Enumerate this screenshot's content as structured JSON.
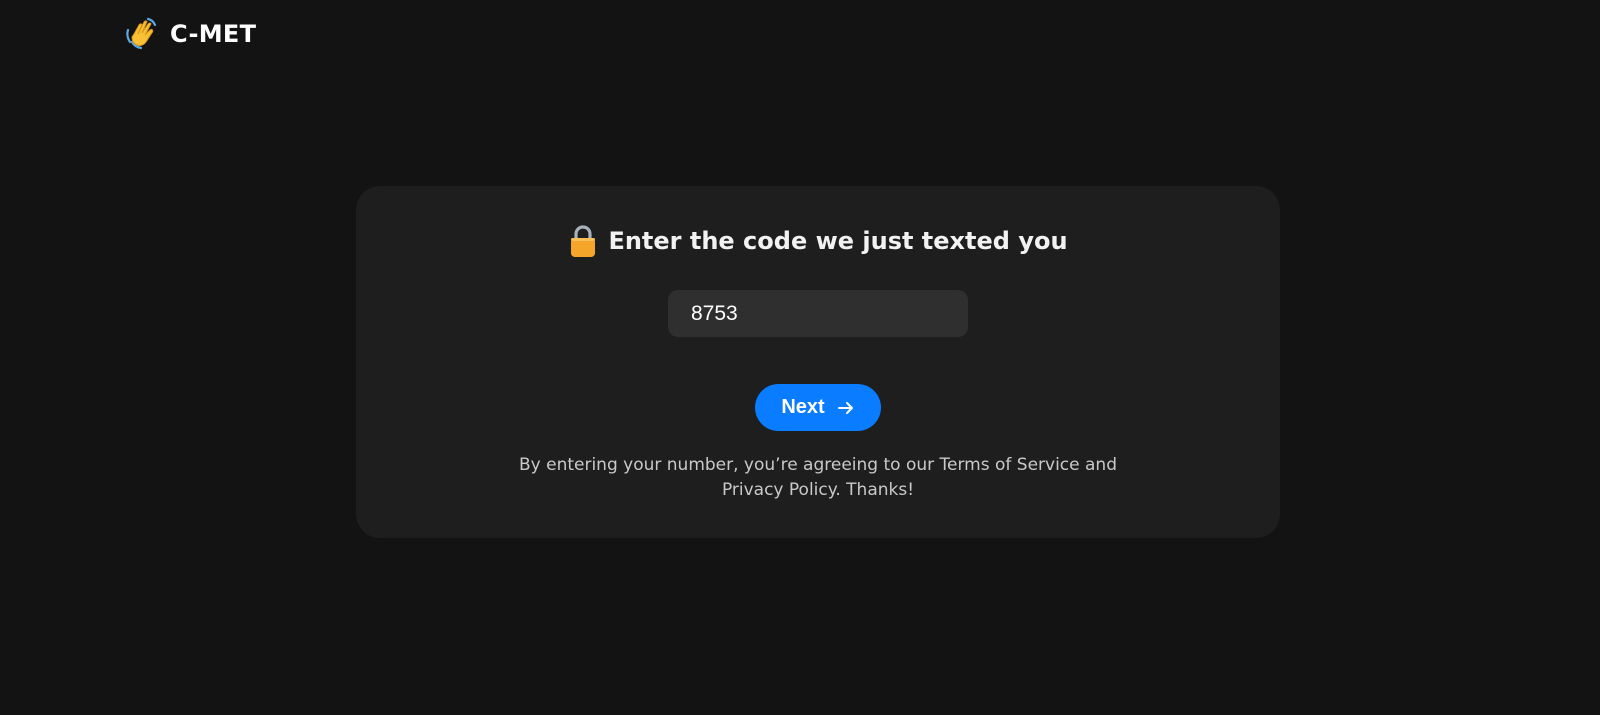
{
  "brand": {
    "name": "C-MET",
    "icon": "waving-hand-icon"
  },
  "verification": {
    "heading": "Enter the code we just texted you",
    "heading_icon": "lock-icon",
    "code_value": "8753",
    "next_label": "Next",
    "next_icon": "arrow-right-icon",
    "disclaimer": "By entering your number, you’re agreeing to our Terms of Service and Privacy Policy. Thanks!"
  },
  "colors": {
    "background": "#131313",
    "card": "#1e1e1e",
    "input": "#2f2f2f",
    "accent": "#0a7cff",
    "lock": "#f5a52a"
  }
}
